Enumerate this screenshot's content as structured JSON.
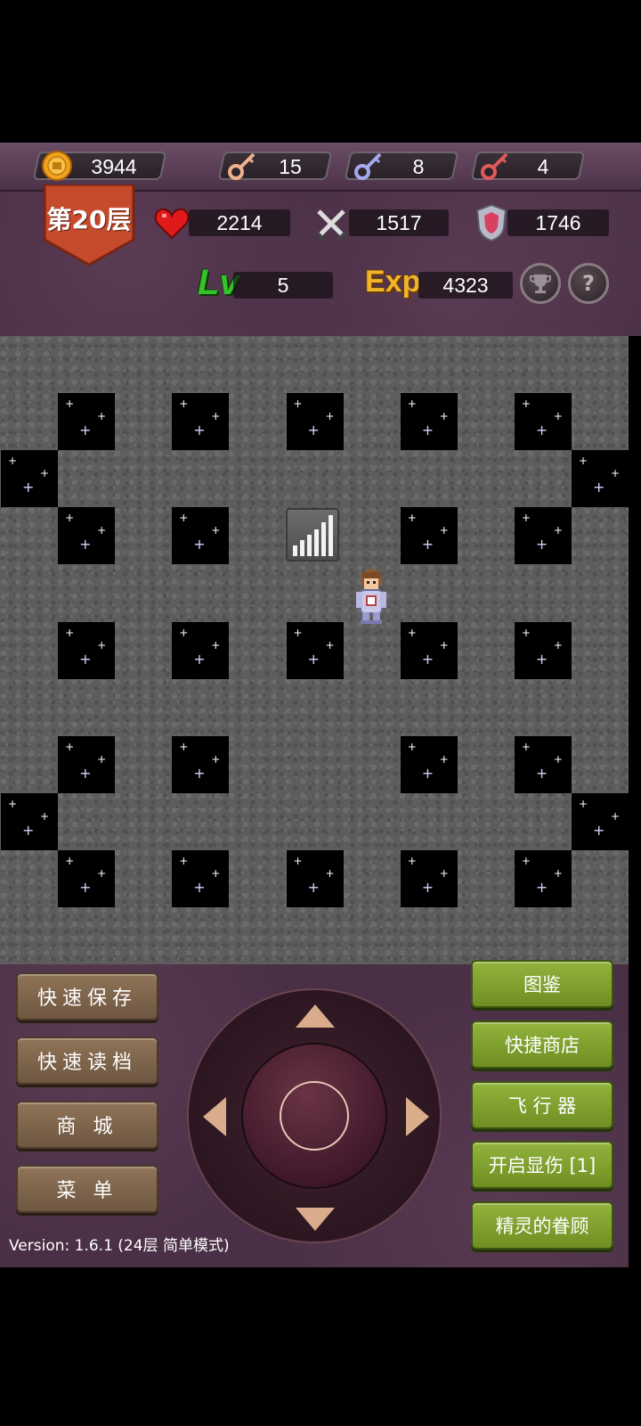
{
  "resources": {
    "gold": "3944",
    "yellow_keys": "15",
    "blue_keys": "8",
    "red_keys": "4"
  },
  "floor": {
    "label": "第20层"
  },
  "stats": {
    "hp": "2214",
    "attack": "1517",
    "defense": "1746",
    "level_label": "Lv",
    "level": "5",
    "exp_label": "Exp",
    "exp": "4323"
  },
  "help_button": "?",
  "left_buttons": {
    "quick_save": "快速保存",
    "quick_load": "快速读档",
    "shop": "商 城",
    "menu": "菜 单"
  },
  "right_buttons": {
    "bestiary": "图鉴",
    "quick_shop": "快捷商店",
    "fly": "飞 行 器",
    "show_damage": "开启显伤 [1]",
    "spirit_blessing": "精灵的眷顾"
  },
  "version": "Version: 1.6.1 (24层 简单模式)",
  "colors": {
    "panel": "#4a3046",
    "green_button": "#7f9f30",
    "brown_button": "#7e6450",
    "floor_banner": "#c64a2c",
    "level_green": "#37c22b",
    "exp_orange": "#f1b42a"
  },
  "icons": {
    "gold": "gold-coin-icon",
    "yellow_key": "yellow-key-icon",
    "blue_key": "blue-key-icon",
    "red_key": "red-key-icon",
    "hp": "heart-icon",
    "attack": "crossed-swords-icon",
    "defense": "shield-icon",
    "trophy": "trophy-icon",
    "help": "question-icon"
  }
}
